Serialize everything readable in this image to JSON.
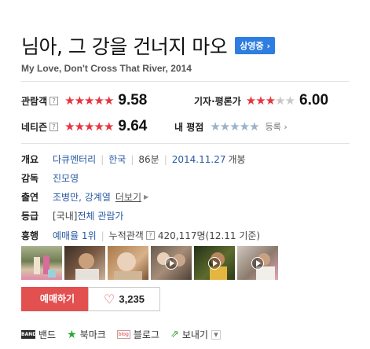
{
  "movie": {
    "title": "님아, 그 강을 건너지 마오",
    "status_badge": "상영중",
    "subtitle": "My Love, Don't Cross That River, 2014"
  },
  "ratings": {
    "audience": {
      "label": "관람객",
      "stars": 5,
      "score": "9.58"
    },
    "critics": {
      "label": "기자·평론가",
      "stars": 3,
      "score": "6.00"
    },
    "netizen": {
      "label": "네티즌",
      "stars": 5,
      "score": "9.64"
    },
    "my": {
      "label": "내 평점",
      "register": "등록"
    }
  },
  "info": {
    "overview_label": "개요",
    "genre": "다큐멘터리",
    "country": "한국",
    "runtime": "86분",
    "release_date": "2014.11.27",
    "release_suffix": "개봉",
    "director_label": "감독",
    "director": "진모영",
    "cast_label": "출연",
    "cast": "조병만, 강계열",
    "more": "더보기",
    "grade_label": "등급",
    "grade_prefix": "[국내]",
    "grade": "전체 관람가",
    "boxoffice_label": "흥행",
    "reservation": "예매율 1위",
    "cumulative_label": "누적관객",
    "cumulative": "420,117명(12.11 기준)"
  },
  "actions": {
    "buy": "예매하기",
    "like_count": "3,235"
  },
  "share": {
    "band": "밴드",
    "bookmark": "북마크",
    "blog": "블로그",
    "send": "보내기"
  },
  "colors": {
    "accent_red": "#e35050",
    "badge_blue": "#2e7de0",
    "link_blue": "#2a5aa3",
    "star_red": "#e8333c",
    "green": "#2ea63a"
  },
  "thumbnails": [
    {
      "name": "still-1",
      "video": false
    },
    {
      "name": "still-2",
      "video": false
    },
    {
      "name": "still-3",
      "video": false
    },
    {
      "name": "video-1",
      "video": true
    },
    {
      "name": "video-2",
      "video": true
    },
    {
      "name": "video-3",
      "video": true
    }
  ]
}
